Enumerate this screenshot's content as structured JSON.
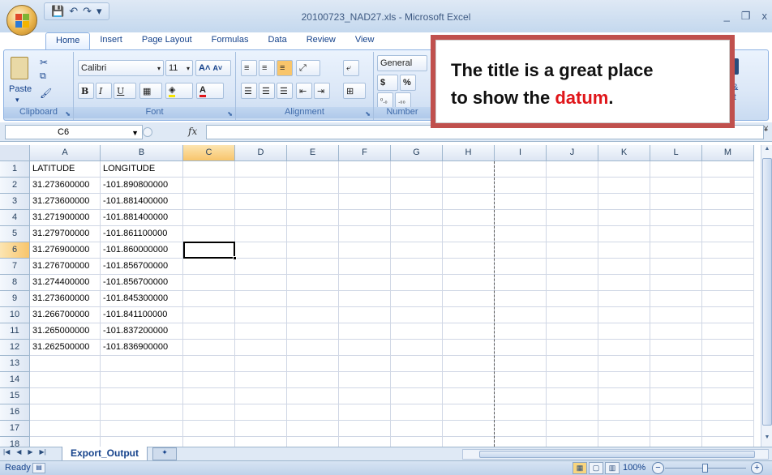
{
  "window": {
    "title": "20100723_NAD27.xls - Microsoft Excel",
    "minimize": "_",
    "restore": "❐",
    "close": "x"
  },
  "qat": {
    "save": "💾",
    "undo": "↶",
    "redo": "↷",
    "customize": "▾"
  },
  "tabs": [
    "Home",
    "Insert",
    "Page Layout",
    "Formulas",
    "Data",
    "Review",
    "View"
  ],
  "ribbon": {
    "clipboard": {
      "label": "Clipboard",
      "paste": "Paste"
    },
    "font": {
      "label": "Font",
      "name": "Calibri",
      "size": "11",
      "grow": "A˄",
      "shrink": "A˅",
      "bold": "B",
      "italic": "I",
      "underline": "U"
    },
    "alignment": {
      "label": "Alignment"
    },
    "number": {
      "label": "Number",
      "format": "General",
      "currency": "$",
      "percent": "%"
    },
    "cells_partial": "&",
    "editing_partial": "rt"
  },
  "formula_bar": {
    "name_box": "C6",
    "fx": "fx",
    "value": ""
  },
  "columns": [
    {
      "id": "A",
      "w": 87
    },
    {
      "id": "B",
      "w": 102
    },
    {
      "id": "C",
      "w": 64
    },
    {
      "id": "D",
      "w": 64
    },
    {
      "id": "E",
      "w": 64
    },
    {
      "id": "F",
      "w": 64
    },
    {
      "id": "G",
      "w": 64
    },
    {
      "id": "H",
      "w": 64
    },
    {
      "id": "I",
      "w": 64
    },
    {
      "id": "J",
      "w": 64
    },
    {
      "id": "K",
      "w": 64
    },
    {
      "id": "L",
      "w": 64
    },
    {
      "id": "M",
      "w": 64
    }
  ],
  "rows": [
    [
      "LATITUDE",
      "LONGITUDE"
    ],
    [
      "31.273600000",
      "-101.890800000"
    ],
    [
      "31.273600000",
      "-101.881400000"
    ],
    [
      "31.271900000",
      "-101.881400000"
    ],
    [
      "31.279700000",
      "-101.861100000"
    ],
    [
      "31.276900000",
      "-101.860000000"
    ],
    [
      "31.276700000",
      "-101.856700000"
    ],
    [
      "31.274400000",
      "-101.856700000"
    ],
    [
      "31.273600000",
      "-101.845300000"
    ],
    [
      "31.266700000",
      "-101.841100000"
    ],
    [
      "31.265000000",
      "-101.837200000"
    ],
    [
      "31.262500000",
      "-101.836900000"
    ],
    [],
    [],
    [],
    [],
    [],
    []
  ],
  "row_numbers": [
    "1",
    "2",
    "3",
    "4",
    "5",
    "6",
    "7",
    "8",
    "9",
    "10",
    "11",
    "12",
    "13",
    "14",
    "15",
    "16",
    "17",
    "18"
  ],
  "active_cell": {
    "col": "C",
    "row": "6"
  },
  "sheet": {
    "tab": "Export_Output"
  },
  "status": {
    "ready": "Ready",
    "zoom": "100%"
  },
  "callout": {
    "before": "The title is a great place",
    "line2_start": "to show the ",
    "highlight": "datum",
    "end": "."
  },
  "colors": {
    "callout_border": "#c0504d",
    "highlight": "#e0161a"
  }
}
